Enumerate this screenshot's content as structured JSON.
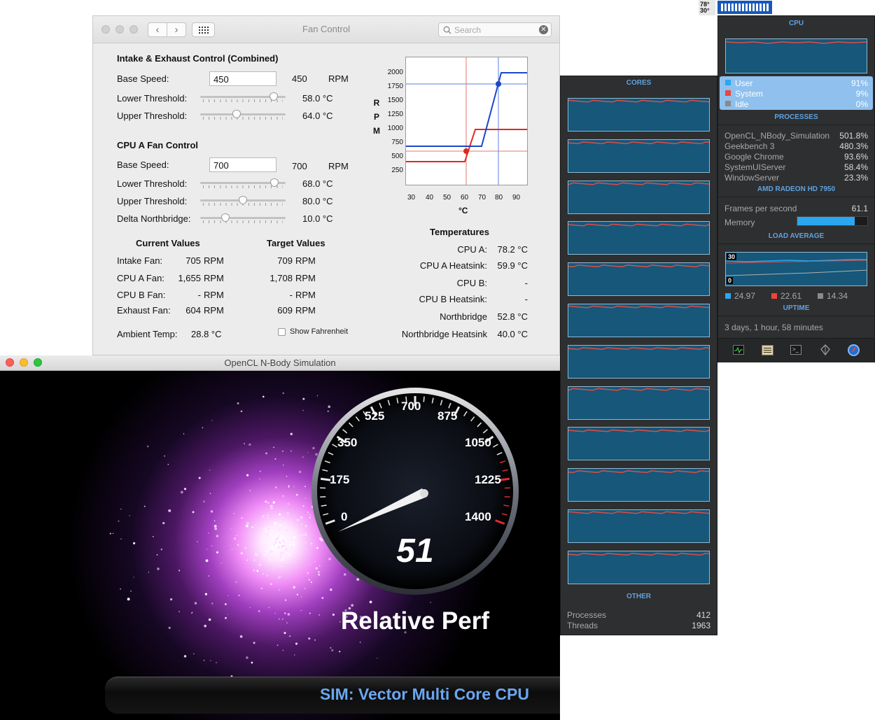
{
  "menubar": {
    "temp_top": "78°",
    "temp_bottom": "30°"
  },
  "fan_control": {
    "title": "Fan Control",
    "search_placeholder": "Search",
    "intake_section": {
      "title": "Intake & Exhaust Control (Combined)",
      "base_speed_label": "Base Speed:",
      "base_speed_input": "450",
      "base_speed_value": "450",
      "base_speed_unit": "RPM",
      "lower_threshold_label": "Lower Threshold:",
      "lower_threshold_value": "58.0 °C",
      "lower_threshold_level": 0.9,
      "upper_threshold_label": "Upper Threshold:",
      "upper_threshold_value": "64.0 °C",
      "upper_threshold_level": 0.42
    },
    "cpu_a_section": {
      "title": "CPU A Fan Control",
      "base_speed_label": "Base Speed:",
      "base_speed_input": "700",
      "base_speed_value": "700",
      "base_speed_unit": "RPM",
      "lower_threshold_label": "Lower Threshold:",
      "lower_threshold_value": "68.0 °C",
      "lower_threshold_level": 0.91,
      "upper_threshold_label": "Upper Threshold:",
      "upper_threshold_value": "80.0 °C",
      "upper_threshold_level": 0.5,
      "delta_label": "Delta Northbridge:",
      "delta_value": "10.0 °C",
      "delta_level": 0.27
    },
    "chart": {
      "ylabel": "R P M",
      "xlabel": "°C",
      "y_ticks": [
        "2000",
        "1750",
        "1500",
        "1250",
        "1000",
        "750",
        "500",
        "250"
      ],
      "x_ticks": [
        "30",
        "40",
        "50",
        "60",
        "70",
        "80",
        "90"
      ]
    },
    "current_values": {
      "header": "Current Values",
      "rows": [
        {
          "label": "Intake Fan:",
          "value": "705",
          "unit": "RPM"
        },
        {
          "label": "CPU A Fan:",
          "value": "1,655",
          "unit": "RPM"
        },
        {
          "label": "CPU B Fan:",
          "value": "-",
          "unit": "RPM"
        },
        {
          "label": "Exhaust Fan:",
          "value": "604",
          "unit": "RPM"
        }
      ]
    },
    "target_values": {
      "header": "Target Values",
      "rows": [
        {
          "value": "709",
          "unit": "RPM"
        },
        {
          "value": "1,708",
          "unit": "RPM"
        },
        {
          "value": "-",
          "unit": "RPM"
        },
        {
          "value": "609",
          "unit": "RPM"
        }
      ]
    },
    "temperatures": {
      "header": "Temperatures",
      "rows": [
        {
          "label": "CPU A:",
          "value": "78.2 °C"
        },
        {
          "label": "CPU A Heatsink:",
          "value": "59.9 °C"
        },
        {
          "label": "CPU B:",
          "value": "-"
        },
        {
          "label": "CPU B Heatsink:",
          "value": "-"
        },
        {
          "label": "Northbridge",
          "value": "52.8 °C"
        },
        {
          "label": "Northbridge Heatsink",
          "value": "40.0 °C"
        }
      ]
    },
    "ambient_label": "Ambient Temp:",
    "ambient_value": "28.8 °C",
    "fahrenheit_label": "Show Fahrenheit"
  },
  "nbody": {
    "title": "OpenCL N-Body Simulation",
    "gauge_ticks": [
      "0",
      "175",
      "350",
      "525",
      "700",
      "875",
      "1050",
      "1225",
      "1400"
    ],
    "gauge_value": "51",
    "gauge_caption": "Relative Perf",
    "sim_label": "SIM: Vector Multi Core CPU"
  },
  "cores_panel": {
    "header": "CORES",
    "core_usage": [
      0.95,
      0.94,
      0.95,
      0.93,
      0.94,
      0.95,
      0.94,
      0.95,
      0.93,
      0.94,
      0.95,
      0.94
    ],
    "other_header": "OTHER",
    "processes_label": "Processes",
    "processes_value": "412",
    "threads_label": "Threads",
    "threads_value": "1963"
  },
  "cpu_panel": {
    "header": "CPU",
    "legend": [
      {
        "label": "User",
        "value": "91%",
        "color": "#2aa7f0"
      },
      {
        "label": "System",
        "value": "9%",
        "color": "#f0433a"
      },
      {
        "label": "Idle",
        "value": "0%",
        "color": "#8a8a8a"
      }
    ],
    "processes_header": "PROCESSES",
    "processes": [
      {
        "name": "OpenCL_NBody_Simulation",
        "value": "501.8%"
      },
      {
        "name": "Geekbench 3",
        "value": "480.3%"
      },
      {
        "name": "Google Chrome",
        "value": "93.6%"
      },
      {
        "name": "SystemUIServer",
        "value": "58.4%"
      },
      {
        "name": "WindowServer",
        "value": "23.3%"
      }
    ],
    "gpu_header": "AMD RADEON HD 7950",
    "fps_label": "Frames per second",
    "fps_value": "61.1",
    "memory_label": "Memory",
    "memory_level": 0.82,
    "load_header": "LOAD AVERAGE",
    "load_scale_top": "30",
    "load_scale_bottom": "0",
    "load_values": [
      {
        "value": "24.97",
        "color": "#2aa7f0"
      },
      {
        "value": "22.61",
        "color": "#f0433a"
      },
      {
        "value": "14.34",
        "color": "#8a8a8a"
      }
    ],
    "uptime_header": "UPTIME",
    "uptime_value": "3 days, 1 hour, 58 minutes"
  },
  "colors": {
    "accent_blue": "#5fa3e0",
    "graph_blue": "#16577a",
    "fan_red": "#e02a1e",
    "fan_blue": "#1c46c8"
  }
}
